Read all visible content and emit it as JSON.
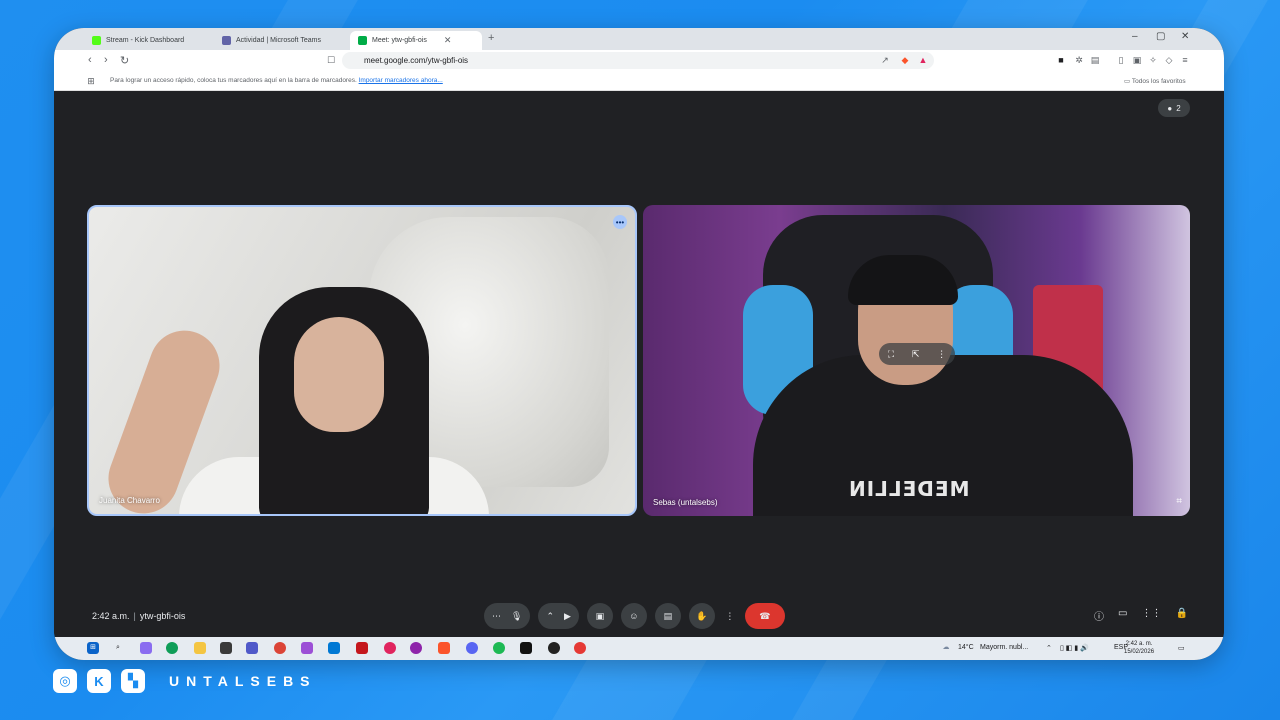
{
  "browser": {
    "tabs": [
      {
        "label": "Stream - Kick Dashboard",
        "icon": "kick-icon",
        "active": false
      },
      {
        "label": "Actividad | Microsoft Teams",
        "icon": "teams-icon",
        "active": false
      },
      {
        "label": "Meet: ytw-gbfi-ois",
        "icon": "meet-icon",
        "active": true
      }
    ],
    "new_tab": "+",
    "url": "meet.google.com/ytw-gbfi-ois",
    "bookmarks": {
      "message": "Para lograr un acceso rápido, coloca tus marcadores aquí en la barra de marcadores.",
      "import_link": "Importar marcadores ahora...",
      "all_bookmarks": "Todos los favoritos"
    },
    "window_controls": {
      "minimize": "–",
      "maximize": "▢",
      "close": "✕"
    }
  },
  "meet": {
    "participant_count": "2",
    "participants": [
      {
        "name": "Juanita Chavarro"
      },
      {
        "name": "Sebas (untalsebs)"
      }
    ],
    "shirt_print": "MEDELLIN",
    "time": "2:42 a.m.",
    "meeting_code": "ytw-gbfi-ois",
    "controls": [
      "more-options",
      "microphone",
      "camera",
      "present",
      "reactions",
      "captions",
      "raise-hand",
      "more",
      "end-call"
    ]
  },
  "taskbar": {
    "weather_temp": "14°C",
    "weather_desc": "Mayorm. nubl...",
    "language": "ESP",
    "clock_time": "2:42 a. m.",
    "clock_date": "15/02/2026"
  },
  "footer": {
    "handle": "UNTALSEBS",
    "socials": [
      "instagram-icon",
      "kick-icon",
      "twitch-icon"
    ]
  },
  "colors": {
    "background": "#1b8cf0",
    "meet_bg": "#202124",
    "end_call": "#dc362e",
    "active_tile_border": "#a8c7fa"
  }
}
